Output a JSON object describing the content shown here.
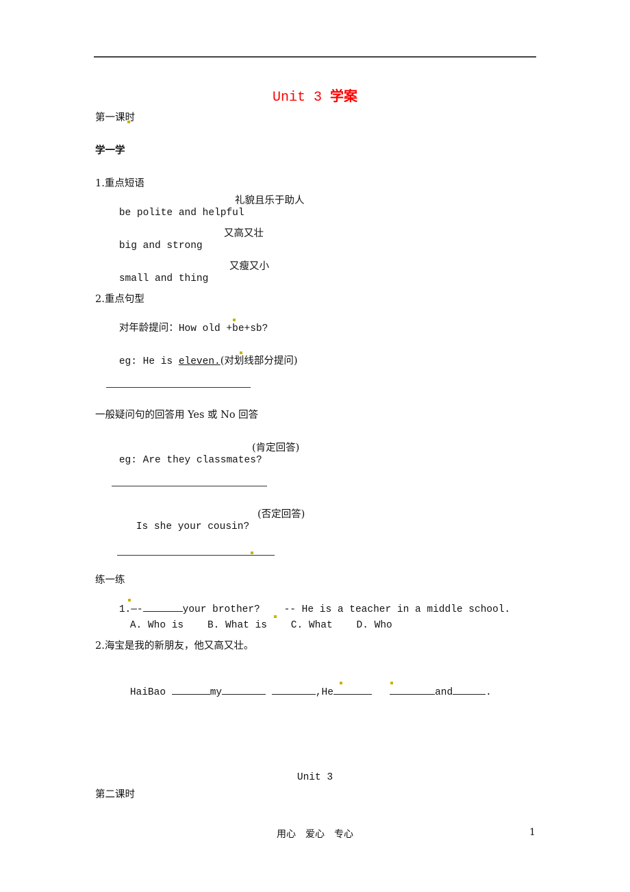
{
  "document": {
    "title_en": "Unit 3 ",
    "title_cn": "学案",
    "lesson1": "第一课时",
    "learn_heading": "学一学",
    "section1_heading": "1.重点短语",
    "phrases": [
      {
        "en": "be polite and helpful",
        "cn": "礼貌且乐于助人"
      },
      {
        "en": "big and strong",
        "cn": "又高又壮"
      },
      {
        "en": "small and thing",
        "cn": "又瘦又小"
      }
    ],
    "section2_heading": "2.重点句型",
    "age_question_label": "对年龄提问：",
    "age_question_pattern": "How old +be+sb?",
    "eg1_prefix": "eg: He is ",
    "eg1_underlined": "eleven.",
    "eg1_suffix": "(对划线部分提问)",
    "yesno_label": "一般疑问句的回答用 Yes 或 No 回答",
    "eg2_question": "eg: Are they classmates?",
    "eg2_note": "(肯定回答)",
    "eg3_question": "Is she your cousin?",
    "eg3_note": "(否定回答)",
    "practice_heading": "练一练",
    "q1_prefix": "1.—-",
    "q1_mid": "your brother?",
    "q1_answer": "-- He is a teacher in a middle school.",
    "q1_options": [
      "A. Who is",
      "B. What is",
      "C. What",
      "D. Who"
    ],
    "q2_prompt": "2.海宝是我的新朋友，他又高又壮。",
    "q2_parts": {
      "p1": "HaiBao ",
      "p2": "my",
      "p3": ",He",
      "p4": "and",
      "p5": "."
    },
    "unit_label": "Unit 3",
    "lesson2": "第二课时"
  },
  "footer": {
    "motto": "用心　爱心　专心",
    "page_number": "1"
  }
}
